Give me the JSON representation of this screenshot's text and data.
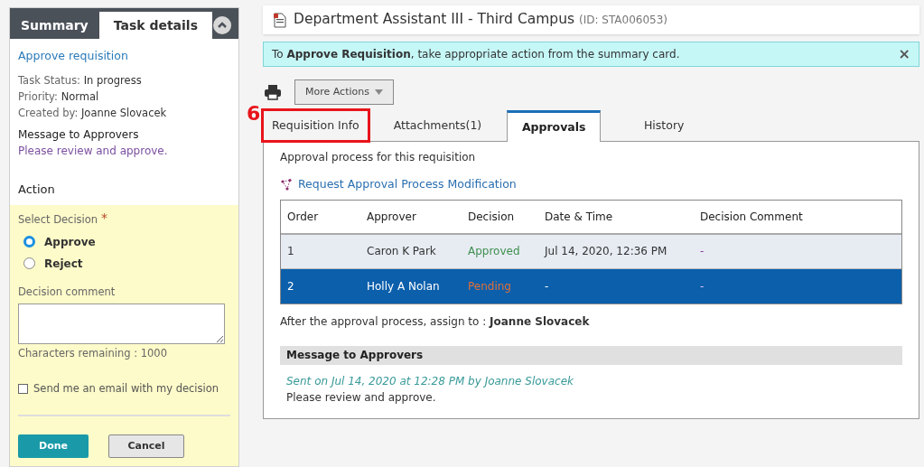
{
  "side_panel": {
    "tabs": [
      {
        "label": "Summary",
        "selected": false
      },
      {
        "label": "Task details",
        "selected": true
      }
    ],
    "task_title": "Approve requisition",
    "fields": [
      {
        "label": "Task Status:",
        "value": "In progress"
      },
      {
        "label": "Priority:",
        "value": "Normal"
      },
      {
        "label": "Created by:",
        "value": "Joanne Slovacek"
      }
    ],
    "message_heading": "Message to Approvers",
    "message": "Please review and approve.",
    "action_heading": "Action",
    "decision_label": "Select Decision",
    "required_mark": "*",
    "decisions": [
      {
        "label": "Approve",
        "selected": true
      },
      {
        "label": "Reject",
        "selected": false
      }
    ],
    "comment_label": "Decision comment",
    "characters_remaining": "Characters remaining : 1000",
    "email_option": {
      "label": "Send me an email with my decision",
      "checked": false
    },
    "buttons": [
      {
        "label": "Done",
        "kind": "primary"
      },
      {
        "label": "Cancel",
        "kind": "secondary"
      }
    ]
  },
  "header": {
    "title": "Department Assistant III - Third Campus",
    "id": "(ID: STA006053)"
  },
  "notice": {
    "text": "To **Approve Requisition**, take appropriate action from the summary card.",
    "close": "×"
  },
  "more_actions": "More Actions",
  "callout": "6",
  "tabs": [
    {
      "label": "Requisition Info",
      "selected": false,
      "highlighted": true
    },
    {
      "label": "Attachments(1)",
      "selected": false,
      "highlighted": false
    },
    {
      "label": "Approvals",
      "selected": true,
      "highlighted": false
    },
    {
      "label": "History",
      "selected": false,
      "highlighted": false
    }
  ],
  "approvals": {
    "intro": "Approval process for this requisition",
    "request_link": "Request Approval Process Modification",
    "columns": [
      "Order",
      "Approver",
      "Decision",
      "Date & Time",
      "Decision Comment"
    ],
    "rows": [
      {
        "order": "1",
        "approver": "Caron K Park",
        "decision": "Approved",
        "color": "#3f8f4f",
        "date": "Jul 14, 2020, 12:36 PM",
        "comment": "-",
        "selected": false
      },
      {
        "order": "2",
        "approver": "Holly A Nolan",
        "decision": "Pending",
        "color": "#e0703a",
        "date": "-",
        "comment": "-",
        "selected": true
      }
    ],
    "assign_text": "After the approval process, assign to : **Joanne Slovacek**",
    "message_heading": "Message to Approvers",
    "message_meta": "Sent on Jul 14, 2020 at 12:28 PM by Joanne Slovacek",
    "message": "Please review and approve."
  }
}
